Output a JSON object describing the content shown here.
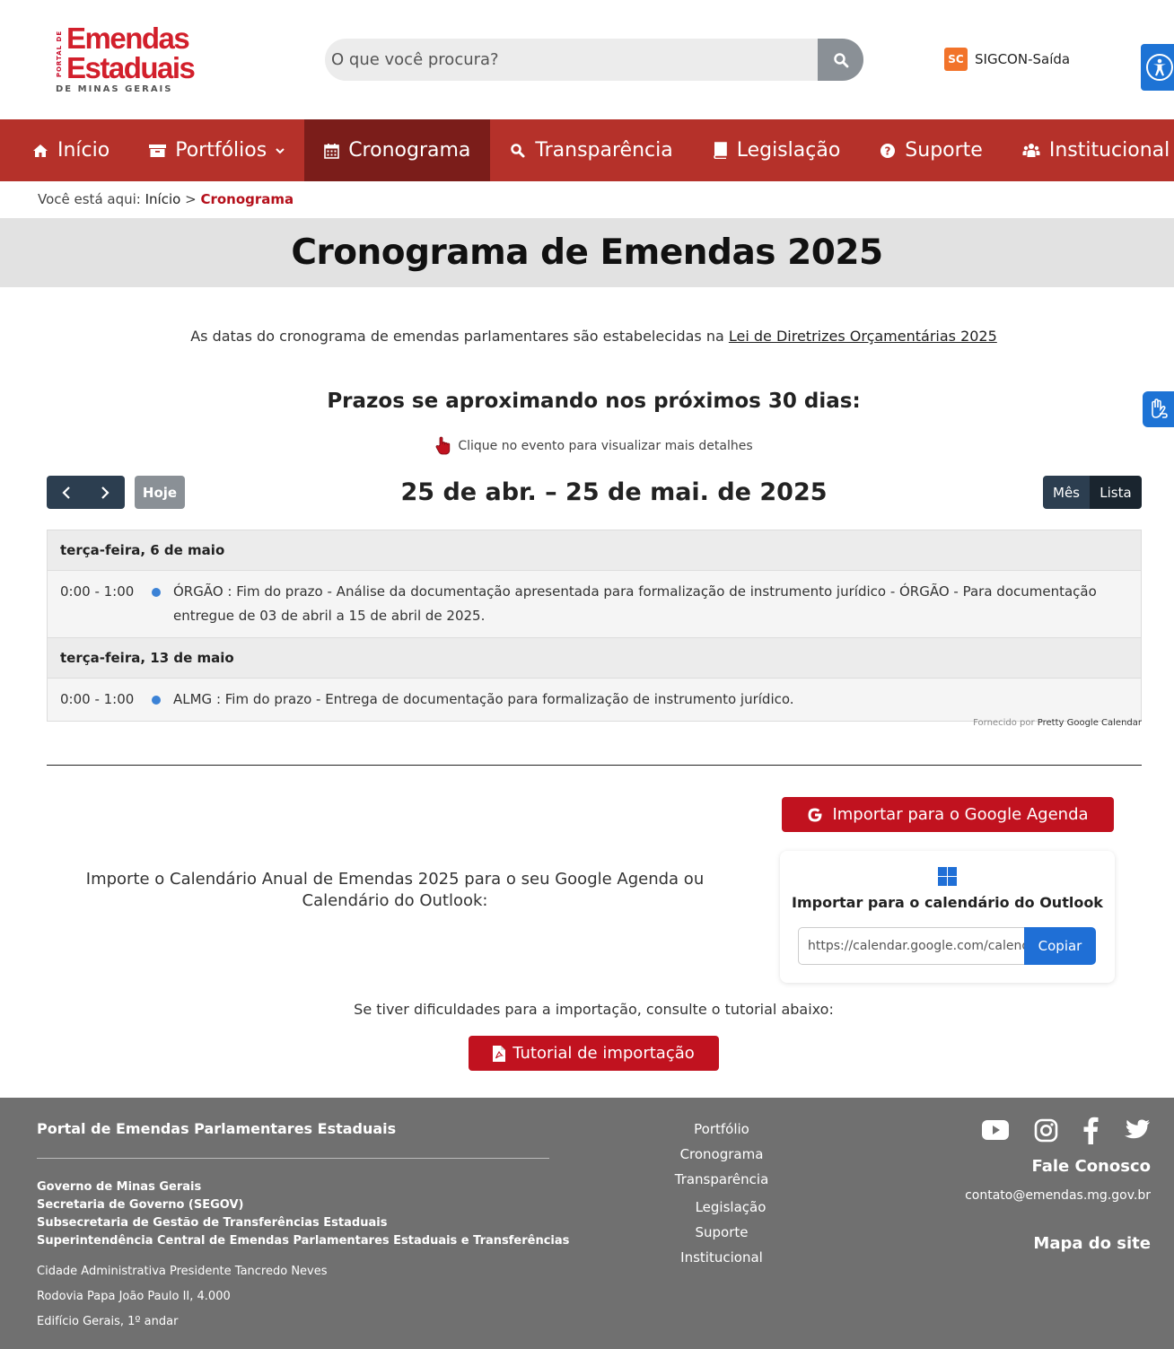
{
  "header": {
    "logo": {
      "side_text": "PORTAL DE",
      "line1": "Emendas",
      "line2": "Estaduais",
      "line3": "DE MINAS GERAIS"
    },
    "search_placeholder": "O que você procura?",
    "sigcon": {
      "badge": "SC",
      "label": "SIGCON-Saída"
    }
  },
  "nav": {
    "items": [
      {
        "label": "Início",
        "icon": "home-icon"
      },
      {
        "label": "Portfólios",
        "icon": "box-icon",
        "dropdown": true
      },
      {
        "label": "Cronograma",
        "icon": "calendar-icon",
        "active": true
      },
      {
        "label": "Transparência",
        "icon": "search-icon"
      },
      {
        "label": "Legislação",
        "icon": "book-icon"
      },
      {
        "label": "Suporte",
        "icon": "question-icon"
      },
      {
        "label": "Institucional",
        "icon": "people-icon"
      }
    ]
  },
  "breadcrumb": {
    "prefix": "Você está aqui:",
    "home": "Início",
    "separator": ">",
    "current": "Cronograma"
  },
  "page_title": "Cronograma de Emendas 2025",
  "intro": {
    "text": "As datas do cronograma de emendas parlamentares são estabelecidas na",
    "link": "Lei de Diretrizes Orçamentárias 2025"
  },
  "deadlines_heading": "Prazos se aproximando nos próximos 30 dias:",
  "hint": "Clique no evento para visualizar mais detalhes",
  "calendar": {
    "today_label": "Hoje",
    "range_title": "25 de abr. – 25 de mai. de 2025",
    "view_month": "Mês",
    "view_list": "Lista",
    "days": [
      {
        "heading": "terça-feira, 6 de maio",
        "events": [
          {
            "time": "0:00 - 1:00",
            "text": "ÓRGÃO : Fim do prazo - Análise da documentação apresentada para formalização de instrumento jurídico - ÓRGÃO - Para documentação entregue de 03 de abril a 15 de abril de 2025."
          }
        ]
      },
      {
        "heading": "terça-feira, 13 de maio",
        "events": [
          {
            "time": "0:00 - 1:00",
            "text": "ALMG : Fim do prazo - Entrega de documentação para formalização de instrumento jurídico."
          }
        ]
      }
    ],
    "credit_prefix": "Fornecido por",
    "credit_name": "Pretty Google Calendar"
  },
  "import": {
    "google_button": "Importar para o Google Agenda",
    "description": "Importe o Calendário Anual de Emendas 2025 para o seu Google Agenda ou Calendário do Outlook:",
    "outlook_title": "Importar para o calendário do Outlook",
    "outlook_url": "https://calendar.google.com/calendar/ical/",
    "copy_button": "Copiar",
    "difficulty_text": "Se tiver dificuldades para a importação, consulte o tutorial abaixo:",
    "tutorial_button": "Tutorial de importação"
  },
  "footer": {
    "title": "Portal de Emendas Parlamentares Estaduais",
    "gov_lines": [
      "Governo de Minas Gerais",
      "Secretaria de Governo (SEGOV)",
      "Subsecretaria de Gestão de Transferências Estaduais"
    ],
    "superintendence": "Superintendência Central de Emendas Parlamentares Estaduais e Transferências",
    "address": [
      "Cidade Administrativa Presidente Tancredo Neves",
      "Rodovia Papa João Paulo II, 4.000",
      "Edifício Gerais, 1º andar"
    ],
    "links": [
      "Portfólio",
      "Cronograma",
      "Transparência",
      "Legislação",
      "Suporte",
      "Institucional"
    ],
    "social_icons": [
      "youtube-icon",
      "instagram-icon",
      "facebook-icon",
      "twitter-icon"
    ],
    "contact_title": "Fale Conosco",
    "contact_email": "contato@emendas.mg.gov.br",
    "sitemap": "Mapa do site"
  },
  "colors": {
    "nav": "#b5312a",
    "nav_active": "#7b1d1a",
    "accent_red": "#c1121f",
    "brand_red": "#d21f2b",
    "blue": "#1f6fd6",
    "footer": "#707070"
  }
}
